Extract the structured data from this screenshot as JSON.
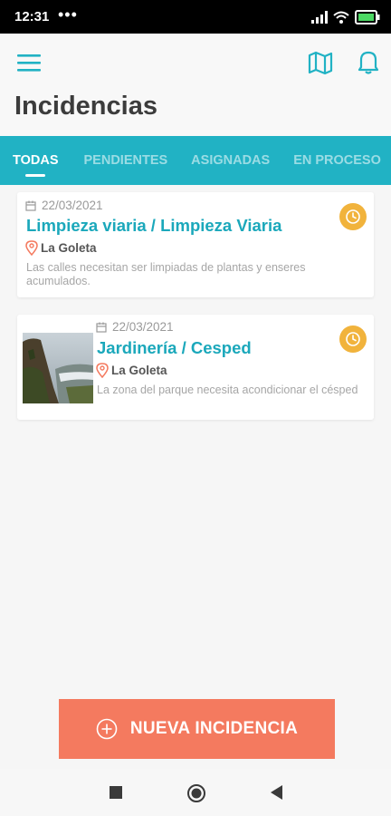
{
  "status_bar": {
    "time": "12:31",
    "dots": "•••"
  },
  "header": {
    "title": "Incidencias"
  },
  "tabs": [
    {
      "label": "TODAS",
      "active": true
    },
    {
      "label": "PENDIENTES",
      "active": false
    },
    {
      "label": "ASIGNADAS",
      "active": false
    },
    {
      "label": "EN PROCESO",
      "active": false
    }
  ],
  "incidents": [
    {
      "date": "22/03/2021",
      "title": "Limpieza viaria / Limpieza Viaria",
      "location": "La Goleta",
      "description": "Las calles necesitan ser limpiadas de plantas y enseres acumulados.",
      "status_icon": "clock-icon"
    },
    {
      "date": "22/03/2021",
      "title": "Jardinería / Cesped",
      "location": "La Goleta",
      "description": "La zona del parque necesita acondicionar el césped",
      "status_icon": "clock-icon",
      "has_image": true
    }
  ],
  "fab": {
    "label": "NUEVA INCIDENCIA",
    "icon": "plus-circle-icon"
  },
  "colors": {
    "accent": "#21b2c4",
    "title_text": "#1ba8bb",
    "fab": "#f47a5f",
    "pending": "#f1b33c",
    "location_pin": "#f47a5f"
  },
  "icons": {
    "header": [
      "menu-icon",
      "map-icon",
      "bell-icon"
    ],
    "card": [
      "calendar-icon",
      "location-pin-icon",
      "clock-icon"
    ],
    "system_nav": [
      "recents-square-icon",
      "home-circle-icon",
      "back-triangle-icon"
    ]
  }
}
